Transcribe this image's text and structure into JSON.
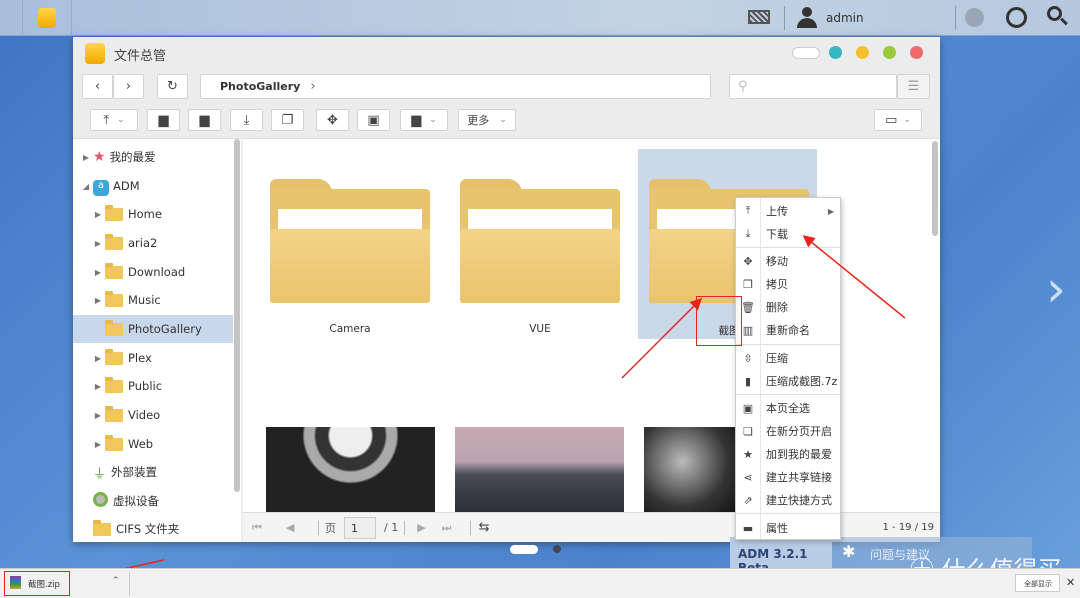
{
  "topbar": {
    "user": "admin"
  },
  "window": {
    "title": "文件总管",
    "breadcrumb": "PhotoGallery",
    "search_placeholder": "",
    "more_label": "更多"
  },
  "sidebar": {
    "items": [
      {
        "label": "我的最爱",
        "icon": "star-icon",
        "expandable": true
      },
      {
        "label": "ADM",
        "icon": "adm-icon",
        "expandable": true,
        "expanded": true
      },
      {
        "label": "Home",
        "icon": "folder-icon",
        "expandable": true
      },
      {
        "label": "aria2",
        "icon": "folder-icon",
        "expandable": true
      },
      {
        "label": "Download",
        "icon": "folder-icon",
        "expandable": true
      },
      {
        "label": "Music",
        "icon": "folder-icon",
        "expandable": true
      },
      {
        "label": "PhotoGallery",
        "icon": "folder-icon",
        "expandable": false,
        "selected": true
      },
      {
        "label": "Plex",
        "icon": "folder-icon",
        "expandable": true
      },
      {
        "label": "Public",
        "icon": "folder-icon",
        "expandable": true
      },
      {
        "label": "Video",
        "icon": "folder-icon",
        "expandable": true
      },
      {
        "label": "Web",
        "icon": "folder-icon",
        "expandable": true
      },
      {
        "label": "外部装置",
        "icon": "usb-icon",
        "expandable": false
      },
      {
        "label": "虚拟设备",
        "icon": "disc-icon",
        "expandable": false
      },
      {
        "label": "CIFS 文件夹",
        "icon": "folder-icon",
        "expandable": false
      }
    ]
  },
  "folders": [
    {
      "name": "Camera"
    },
    {
      "name": "VUE"
    },
    {
      "name": "截图",
      "selected": true
    }
  ],
  "pager": {
    "page_label": "页",
    "page": "1",
    "total_pages": "/ 1",
    "range": "1 - 19 / 19"
  },
  "context_menu": {
    "items": [
      {
        "label": "上传",
        "icon": "upload-icon",
        "submenu": true
      },
      {
        "label": "下载",
        "icon": "download-icon"
      },
      {
        "label": "移动",
        "icon": "move-icon"
      },
      {
        "label": "拷贝",
        "icon": "copy-icon"
      },
      {
        "label": "删除",
        "icon": "trash-icon"
      },
      {
        "label": "重新命名",
        "icon": "rename-icon"
      },
      {
        "label": "压缩",
        "icon": "compress-icon"
      },
      {
        "label": "压缩成截图.7z",
        "icon": "archive-icon"
      },
      {
        "label": "本页全选",
        "icon": "select-all-icon"
      },
      {
        "label": "在新分页开启",
        "icon": "new-tab-icon"
      },
      {
        "label": "加到我的最爱",
        "icon": "star-icon"
      },
      {
        "label": "建立共享链接",
        "icon": "share-icon"
      },
      {
        "label": "建立快捷方式",
        "icon": "shortcut-icon"
      },
      {
        "label": "属性",
        "icon": "properties-icon"
      }
    ]
  },
  "taskbar": {
    "version": "ADM 3.2.1 Beta",
    "feedback": "问题与建议"
  },
  "download_bar": {
    "file": "截图.zip",
    "show_all": "全部显示"
  },
  "watermark": "值 什么值得买"
}
